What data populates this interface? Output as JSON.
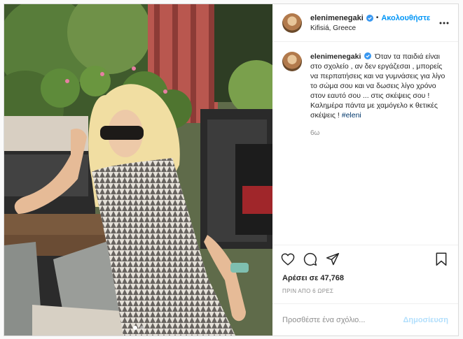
{
  "post": {
    "username": "elenimenegaki",
    "verified": true,
    "follow_separator": "•",
    "follow_label": "Ακολουθήστε",
    "location": "Kifisiá, Greece",
    "more_icon": "more-horizontal-icon",
    "carousel": {
      "total": 2,
      "active_index": 0
    }
  },
  "caption": {
    "username": "elenimenegaki",
    "text": "Όταν τα παιδιά είναι στο σχολείο , αν δεν εργάζεσαι , μπορείς να περπατήσεις και να γυμνάσεις για λίγο το σώμα σου και να δωσεις λίγο χρόνο στον εαυτό σου ... στις σκέψεις σου ! Καλημέρα πάντα με χαμόγελο κ θετικές σκέψεις ! ",
    "hashtag": "#eleni",
    "time_ago": "6ω"
  },
  "actions": {
    "like_icon": "heart-icon",
    "comment_icon": "comment-icon",
    "share_icon": "share-icon",
    "save_icon": "bookmark-icon"
  },
  "likes": "Αρέσει σε 47,768",
  "posted": "ΠΡΙΝ ΑΠΟ 6 ΩΡΕΣ",
  "comment": {
    "placeholder": "Προσθέστε ένα σχόλιο...",
    "post_label": "Δημοσίευση"
  },
  "colors": {
    "accent": "#0095f6",
    "post_disabled": "#b2dffc",
    "hashtag": "#00376b",
    "muted": "#8e8e8e"
  }
}
